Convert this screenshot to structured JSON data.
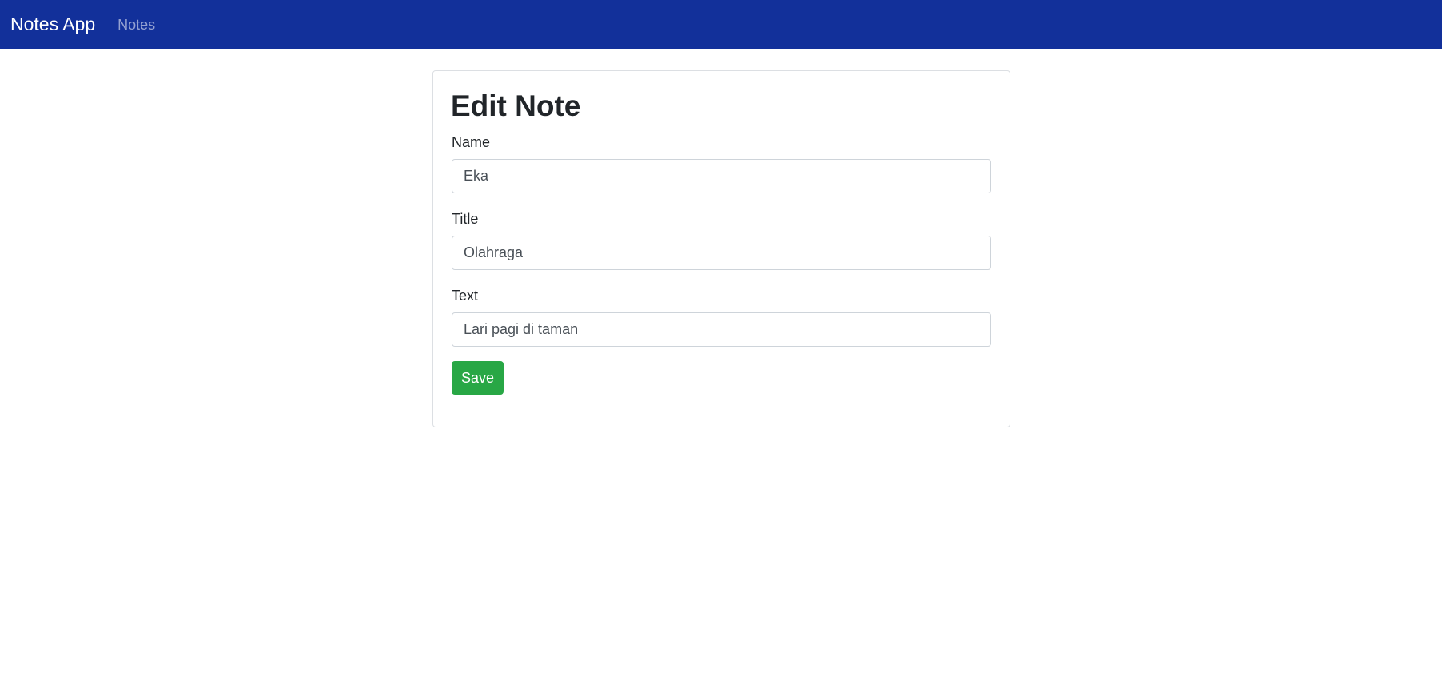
{
  "navbar": {
    "brand": "Notes App",
    "links": [
      {
        "label": "Notes"
      }
    ],
    "background_color": "#12309a"
  },
  "form": {
    "heading": "Edit Note",
    "fields": [
      {
        "label": "Name",
        "value": "Eka"
      },
      {
        "label": "Title",
        "value": "Olahraga"
      },
      {
        "label": "Text",
        "value": "Lari pagi di taman"
      }
    ],
    "save_label": "Save",
    "save_color": "#28a745"
  }
}
